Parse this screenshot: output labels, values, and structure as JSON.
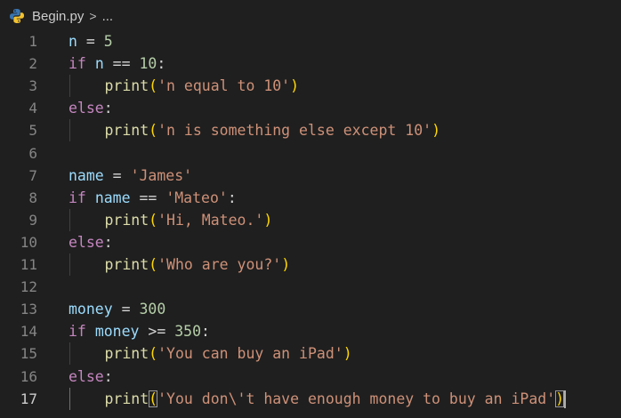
{
  "breadcrumb": {
    "file": "Begin.py",
    "separator": ">",
    "more": "..."
  },
  "icons": {
    "file_icon": "python-icon"
  },
  "editor": {
    "active_line": 17,
    "lines": [
      {
        "num": "1",
        "tokens": [
          [
            "var",
            "n"
          ],
          [
            "op",
            " = "
          ],
          [
            "num",
            "5"
          ]
        ]
      },
      {
        "num": "2",
        "tokens": [
          [
            "kw",
            "if"
          ],
          [
            "op",
            " "
          ],
          [
            "var",
            "n"
          ],
          [
            "op",
            " == "
          ],
          [
            "num",
            "10"
          ],
          [
            "op",
            ":"
          ]
        ]
      },
      {
        "num": "3",
        "indent": true,
        "tokens": [
          [
            "fn",
            "print"
          ],
          [
            "br",
            "("
          ],
          [
            "str",
            "'n equal to 10'"
          ],
          [
            "br",
            ")"
          ]
        ]
      },
      {
        "num": "4",
        "tokens": [
          [
            "kw",
            "else"
          ],
          [
            "op",
            ":"
          ]
        ]
      },
      {
        "num": "5",
        "indent": true,
        "tokens": [
          [
            "fn",
            "print"
          ],
          [
            "br",
            "("
          ],
          [
            "str",
            "'n is something else except 10'"
          ],
          [
            "br",
            ")"
          ]
        ]
      },
      {
        "num": "6",
        "tokens": []
      },
      {
        "num": "7",
        "tokens": [
          [
            "var",
            "name"
          ],
          [
            "op",
            " = "
          ],
          [
            "str",
            "'James'"
          ]
        ]
      },
      {
        "num": "8",
        "tokens": [
          [
            "kw",
            "if"
          ],
          [
            "op",
            " "
          ],
          [
            "var",
            "name"
          ],
          [
            "op",
            " == "
          ],
          [
            "str",
            "'Mateo'"
          ],
          [
            "op",
            ":"
          ]
        ]
      },
      {
        "num": "9",
        "indent": true,
        "tokens": [
          [
            "fn",
            "print"
          ],
          [
            "br",
            "("
          ],
          [
            "str",
            "'Hi, Mateo.'"
          ],
          [
            "br",
            ")"
          ]
        ]
      },
      {
        "num": "10",
        "tokens": [
          [
            "kw",
            "else"
          ],
          [
            "op",
            ":"
          ]
        ]
      },
      {
        "num": "11",
        "indent": true,
        "tokens": [
          [
            "fn",
            "print"
          ],
          [
            "br",
            "("
          ],
          [
            "str",
            "'Who are you?'"
          ],
          [
            "br",
            ")"
          ]
        ]
      },
      {
        "num": "12",
        "tokens": []
      },
      {
        "num": "13",
        "tokens": [
          [
            "var",
            "money"
          ],
          [
            "op",
            " = "
          ],
          [
            "num",
            "300"
          ]
        ]
      },
      {
        "num": "14",
        "tokens": [
          [
            "kw",
            "if"
          ],
          [
            "op",
            " "
          ],
          [
            "var",
            "money"
          ],
          [
            "op",
            " >= "
          ],
          [
            "num",
            "350"
          ],
          [
            "op",
            ":"
          ]
        ]
      },
      {
        "num": "15",
        "indent": true,
        "tokens": [
          [
            "fn",
            "print"
          ],
          [
            "br",
            "("
          ],
          [
            "str",
            "'You can buy an iPad'"
          ],
          [
            "br",
            ")"
          ]
        ]
      },
      {
        "num": "16",
        "tokens": [
          [
            "kw",
            "else"
          ],
          [
            "op",
            ":"
          ]
        ]
      },
      {
        "num": "17",
        "indent": true,
        "tokens": [
          [
            "fn",
            "print"
          ],
          [
            "br-box",
            "("
          ],
          [
            "str",
            "'You don\\'t have enough money to buy an iPad'"
          ],
          [
            "br-box",
            ")"
          ]
        ]
      }
    ]
  },
  "colors": {
    "background": "#1f1f1f",
    "keyword": "#c586c0",
    "variable": "#9cdcfe",
    "number": "#b5cea8",
    "string": "#ce9178",
    "function": "#dcdcaa",
    "bracket": "#ffd700"
  }
}
